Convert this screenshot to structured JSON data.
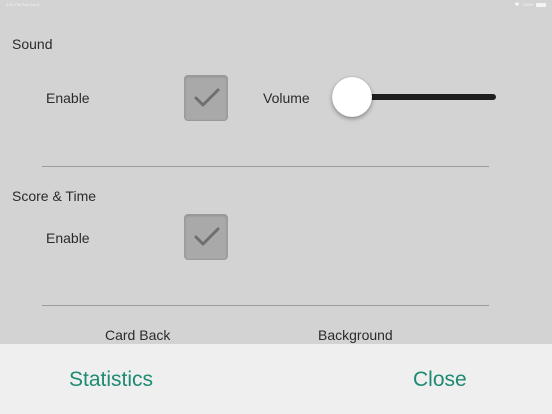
{
  "statusbar": {
    "time_date": "2:40 PM  Tue Oct 8",
    "battery": "100%"
  },
  "sound": {
    "title": "Sound",
    "enable_label": "Enable",
    "enable_checked": true,
    "volume_label": "Volume",
    "volume_level": 0.0
  },
  "score_time": {
    "title": "Score & Time",
    "enable_label": "Enable",
    "enable_checked": true
  },
  "options": {
    "card_back_label": "Card Back",
    "background_label": "Background"
  },
  "bottom_bar": {
    "statistics_label": "Statistics",
    "close_label": "Close"
  },
  "colors": {
    "accent": "#1e8a72",
    "background": "#d3d3d3",
    "bottom_bar": "#efefef"
  },
  "icons": {
    "checkbox": "checkmark-icon",
    "wifi": "wifi-icon",
    "battery": "battery-icon"
  }
}
